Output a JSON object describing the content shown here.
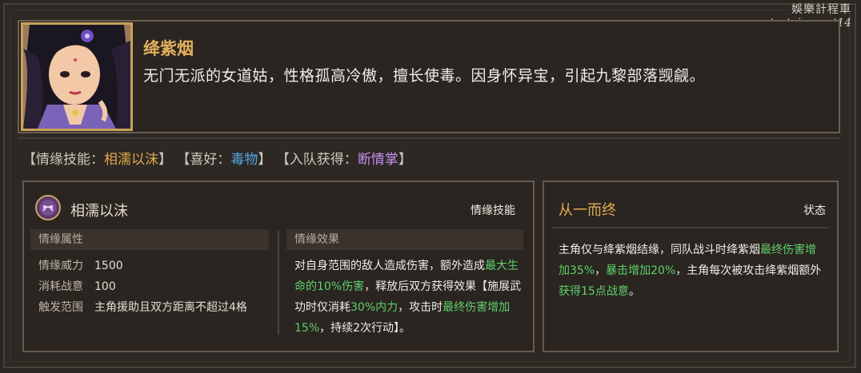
{
  "watermark": {
    "line1": "娛樂計程車",
    "line2": "entertainment14"
  },
  "character": {
    "name": "绛紫烟",
    "description": "无门无派的女道姑，性格孤高冷傲，擅长使毒。因身怀异宝，引起九黎部落觊觎。"
  },
  "tags": {
    "skill_label": "【情缘技能：",
    "skill_value": "相濡以沫",
    "skill_end": "】",
    "like_label": "【喜好：",
    "like_value": "毒物",
    "like_end": "】",
    "join_label": "【入队获得：",
    "join_value": "断情掌",
    "join_end": "】"
  },
  "skill": {
    "name": "相濡以沫",
    "type": "情缘技能",
    "attr_header": "情缘属性",
    "effect_header": "情缘效果",
    "attrs": [
      {
        "label": "情缘威力",
        "value": "1500"
      },
      {
        "label": "消耗战意",
        "value": "100"
      },
      {
        "label": "触发范围",
        "value": "主角援助且双方距离不超过4格"
      }
    ],
    "effect": {
      "p1": "对自身范围的敌人造成伤害，额外造成",
      "g1": "最大生命的10%伤害",
      "p2": "，释放后双方获得效果【施展武功时仅消耗",
      "g2": "30%内力",
      "p3": "，攻击时",
      "g3": "最终伤害增加15%",
      "p4": "，持续2次行动】。"
    }
  },
  "status": {
    "name": "从一而终",
    "type": "状态",
    "p1": "主角仅与绛紫烟结缘，同队战斗时绛紫烟",
    "g1": "最终伤害增加35%",
    "p2": "，",
    "g2": "暴击增加20%",
    "p3": "，主角每次被攻击绛紫烟额外",
    "g3": "获得15点战意",
    "p4": "。"
  },
  "colors": {
    "name_gold": "#e3b15c",
    "tag_orange": "#e1a74a",
    "tag_blue": "#4fa7e3",
    "tag_purple": "#c78ef0",
    "highlight_green": "#5fd06a"
  }
}
